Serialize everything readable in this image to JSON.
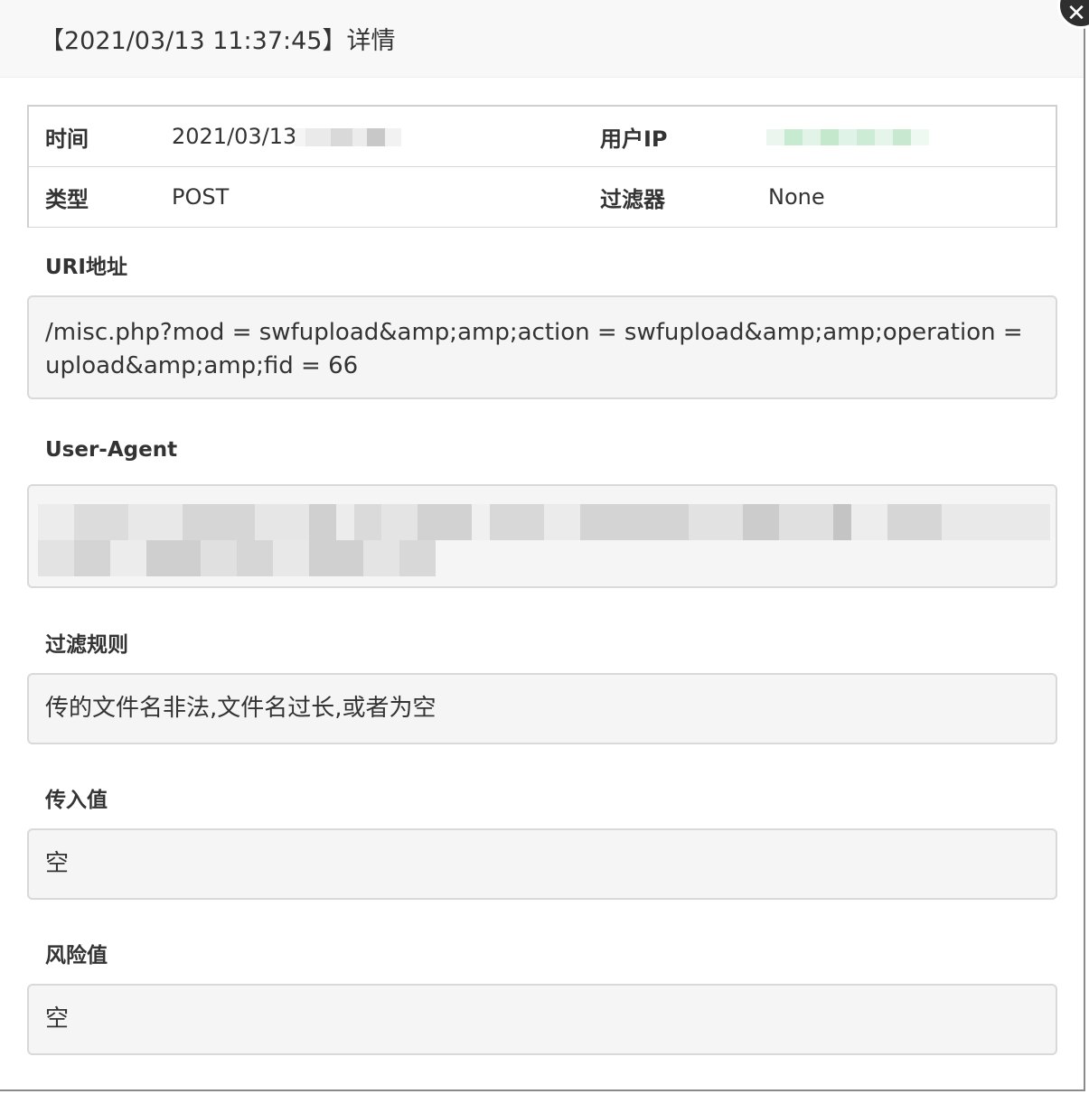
{
  "dialog": {
    "title": "【2021/03/13 11:37:45】详情",
    "close_glyph": "✕"
  },
  "info": {
    "time_label": "时间",
    "time_value": "2021/03/13",
    "ip_label": "用户IP",
    "ip_value": "",
    "type_label": "类型",
    "type_value": "POST",
    "filter_label": "过滤器",
    "filter_value": "None"
  },
  "uri": {
    "label": "URI地址",
    "value": "/misc.php?mod = swfupload&amp;amp;action = swfupload&amp;amp;operation = upload&amp;amp;fid = 66"
  },
  "user_agent": {
    "label": "User-Agent",
    "value": ""
  },
  "rule": {
    "label": "过滤规则",
    "value": "传的文件名非法,文件名过长,或者为空"
  },
  "input_value": {
    "label": "传入值",
    "value": "空"
  },
  "risk_value": {
    "label": "风险值",
    "value": "空"
  }
}
